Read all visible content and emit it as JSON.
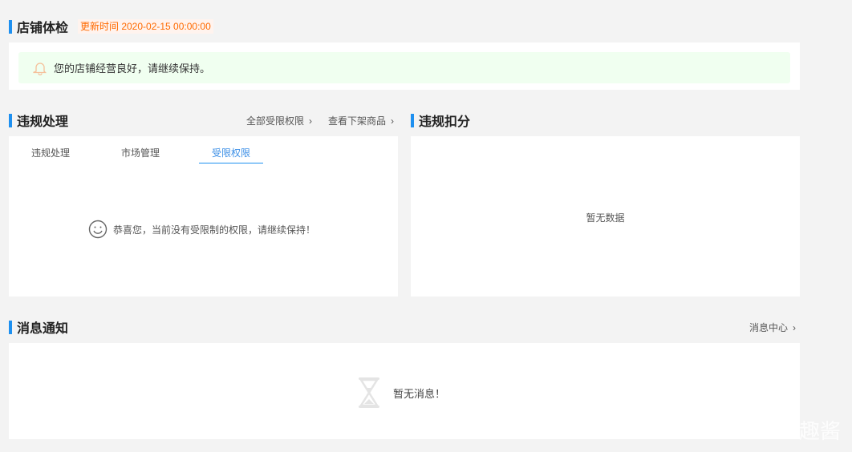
{
  "health": {
    "title": "店铺体检",
    "update_time": "更新时间 2020-02-15 00:00:00",
    "notice": "您的店铺经营良好，请继续保持。"
  },
  "violation": {
    "title": "违规处理",
    "links": [
      "全部受限权限",
      "查看下架商品"
    ],
    "tabs": [
      {
        "label": "违规处理"
      },
      {
        "label": "市场管理"
      },
      {
        "label": "受限权限",
        "active": true
      }
    ],
    "message": "恭喜您，当前没有受限制的权限，请继续保持！"
  },
  "deduction": {
    "title": "违规扣分",
    "empty": "暂无数据"
  },
  "messages": {
    "title": "消息通知",
    "link": "消息中心",
    "empty": "暂无消息！"
  },
  "watermark": "趣酱",
  "colors": {
    "accent": "#1e90f0",
    "update_time": "#ff6a00",
    "notice_bg": "#f0fff0"
  }
}
